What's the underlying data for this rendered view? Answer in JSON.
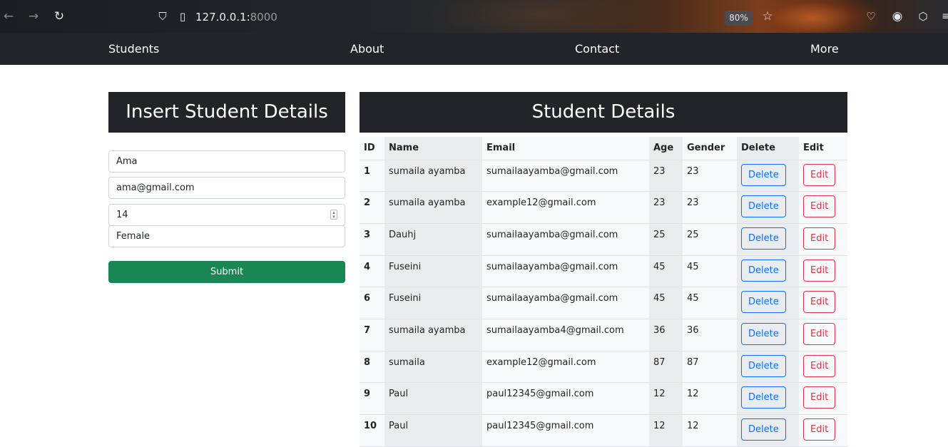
{
  "browser": {
    "url_host": "127.0.0.1:",
    "url_port": "8000",
    "zoom": "80%"
  },
  "navbar": {
    "items": [
      {
        "label": "Students"
      },
      {
        "label": "About"
      },
      {
        "label": "Contact"
      },
      {
        "label": "More"
      }
    ]
  },
  "form": {
    "title": "Insert Student Details",
    "name_value": "Ama",
    "email_value": "ama@gmail.com",
    "age_value": "14",
    "gender_value": "Female",
    "submit_label": "Submit"
  },
  "table": {
    "title": "Student Details",
    "headers": [
      "ID",
      "Name",
      "Email",
      "Age",
      "Gender",
      "Delete",
      "Edit"
    ],
    "delete_label": "Delete",
    "edit_label": "Edit",
    "rows": [
      {
        "id": "1",
        "name": "sumaila ayamba",
        "email": "sumailaayamba@gmail.com",
        "age": "23",
        "gender": "23"
      },
      {
        "id": "2",
        "name": "sumaila ayamba",
        "email": "example12@gmail.com",
        "age": "23",
        "gender": "23"
      },
      {
        "id": "3",
        "name": "Dauhj",
        "email": "sumailaayamba@gmail.com",
        "age": "25",
        "gender": "25"
      },
      {
        "id": "4",
        "name": "Fuseini",
        "email": "sumailaayamba@gmail.com",
        "age": "45",
        "gender": "45"
      },
      {
        "id": "6",
        "name": "Fuseini",
        "email": "sumailaayamba@gmail.com",
        "age": "45",
        "gender": "45"
      },
      {
        "id": "7",
        "name": "sumaila ayamba",
        "email": "sumailaayamba4@gmail.com",
        "age": "36",
        "gender": "36"
      },
      {
        "id": "8",
        "name": "sumaila",
        "email": "example12@gmail.com",
        "age": "87",
        "gender": "87"
      },
      {
        "id": "9",
        "name": "Paul",
        "email": "paul12345@gmail.com",
        "age": "12",
        "gender": "12"
      },
      {
        "id": "10",
        "name": "Paul",
        "email": "paul12345@gmail.com",
        "age": "12",
        "gender": "12"
      }
    ]
  }
}
